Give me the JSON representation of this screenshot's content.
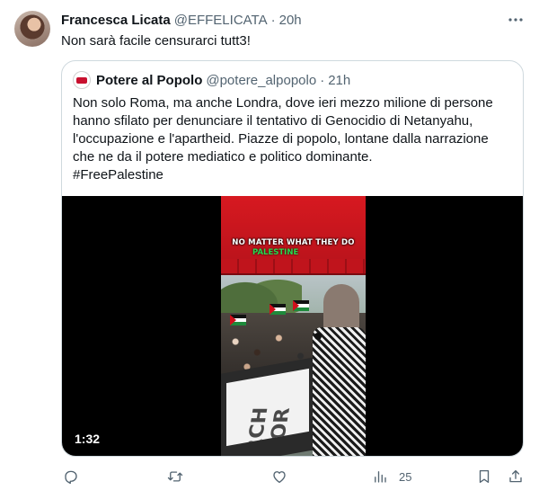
{
  "tweet": {
    "author_name": "Francesca Licata",
    "author_handle": "@EFFELICATA",
    "separator": "·",
    "time": "20h",
    "text": "Non sarà facile censurarci tutt3!",
    "more_icon": "more-dots-icon"
  },
  "quote": {
    "author_name": "Potere al Popolo",
    "author_handle": "@potere_alpopolo",
    "separator": "·",
    "time": "21h",
    "text_lines": [
      "Non solo Roma, ma anche Londra, dove ieri mezzo milione di persone",
      "hanno sfilato per denunciare il tentativo di Genocidio di Netanyahu,",
      "l'occupazione e l'apartheid. Piazze di popolo, lontane dalla narrazione",
      "che ne da il potere mediatico e politico dominante.",
      "#FreePalestine"
    ],
    "video": {
      "duration": "1:32",
      "caption_line1": "NO MATTER WHAT THEY DO",
      "caption_line2": "PALESTINE",
      "banner_text": "RCH FOR"
    }
  },
  "actions": {
    "reply_icon": "reply-icon",
    "retweet_icon": "retweet-icon",
    "like_icon": "heart-icon",
    "views_icon": "views-chart-icon",
    "views_count": "25",
    "bookmark_icon": "bookmark-icon",
    "share_icon": "share-icon"
  },
  "colors": {
    "text_primary": "#0f1419",
    "text_secondary": "#536471",
    "border": "#cfd9de",
    "video_bg": "#000000"
  }
}
